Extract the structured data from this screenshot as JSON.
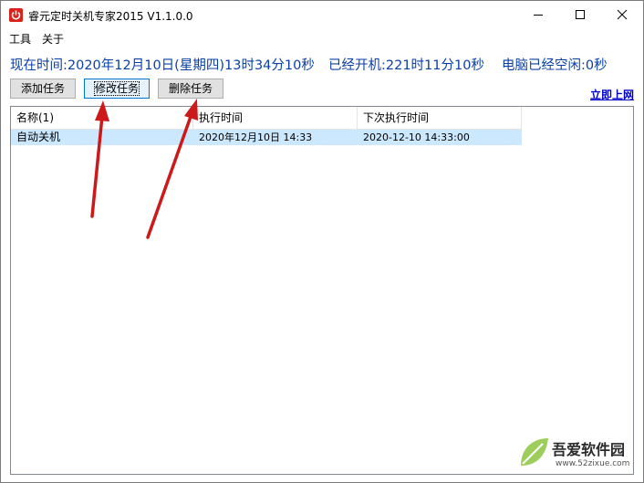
{
  "window": {
    "title": "睿元定时关机专家2015 V1.1.0.0"
  },
  "menu": {
    "items": [
      "工具",
      "关于"
    ]
  },
  "status": {
    "current_time": "现在时间:2020年12月10日(星期四)13时34分10秒",
    "uptime": "已经开机:221时11分10秒",
    "idle": "电脑已经空闲:0秒"
  },
  "toolbar": {
    "add_label": "添加任务",
    "edit_label": "修改任务",
    "delete_label": "删除任务",
    "online_label": "立即上网"
  },
  "list": {
    "columns": [
      "名称(1)",
      "执行时间",
      "下次执行时间"
    ],
    "rows": [
      {
        "name": "自动关机",
        "exec_time": "2020年12月10日 14:33",
        "next_time": "2020-12-10 14:33:00"
      }
    ]
  },
  "watermark": {
    "text": "吾爱软件园",
    "url": "www.52zixue.com"
  },
  "colors": {
    "status_text": "#0b3fa8",
    "selection": "#cce8ff",
    "arrow": "#cc1a1a",
    "link": "#0000cc"
  },
  "icons": {
    "app": "power-icon",
    "minimize": "minimize-icon",
    "maximize": "maximize-icon",
    "close": "close-icon"
  }
}
